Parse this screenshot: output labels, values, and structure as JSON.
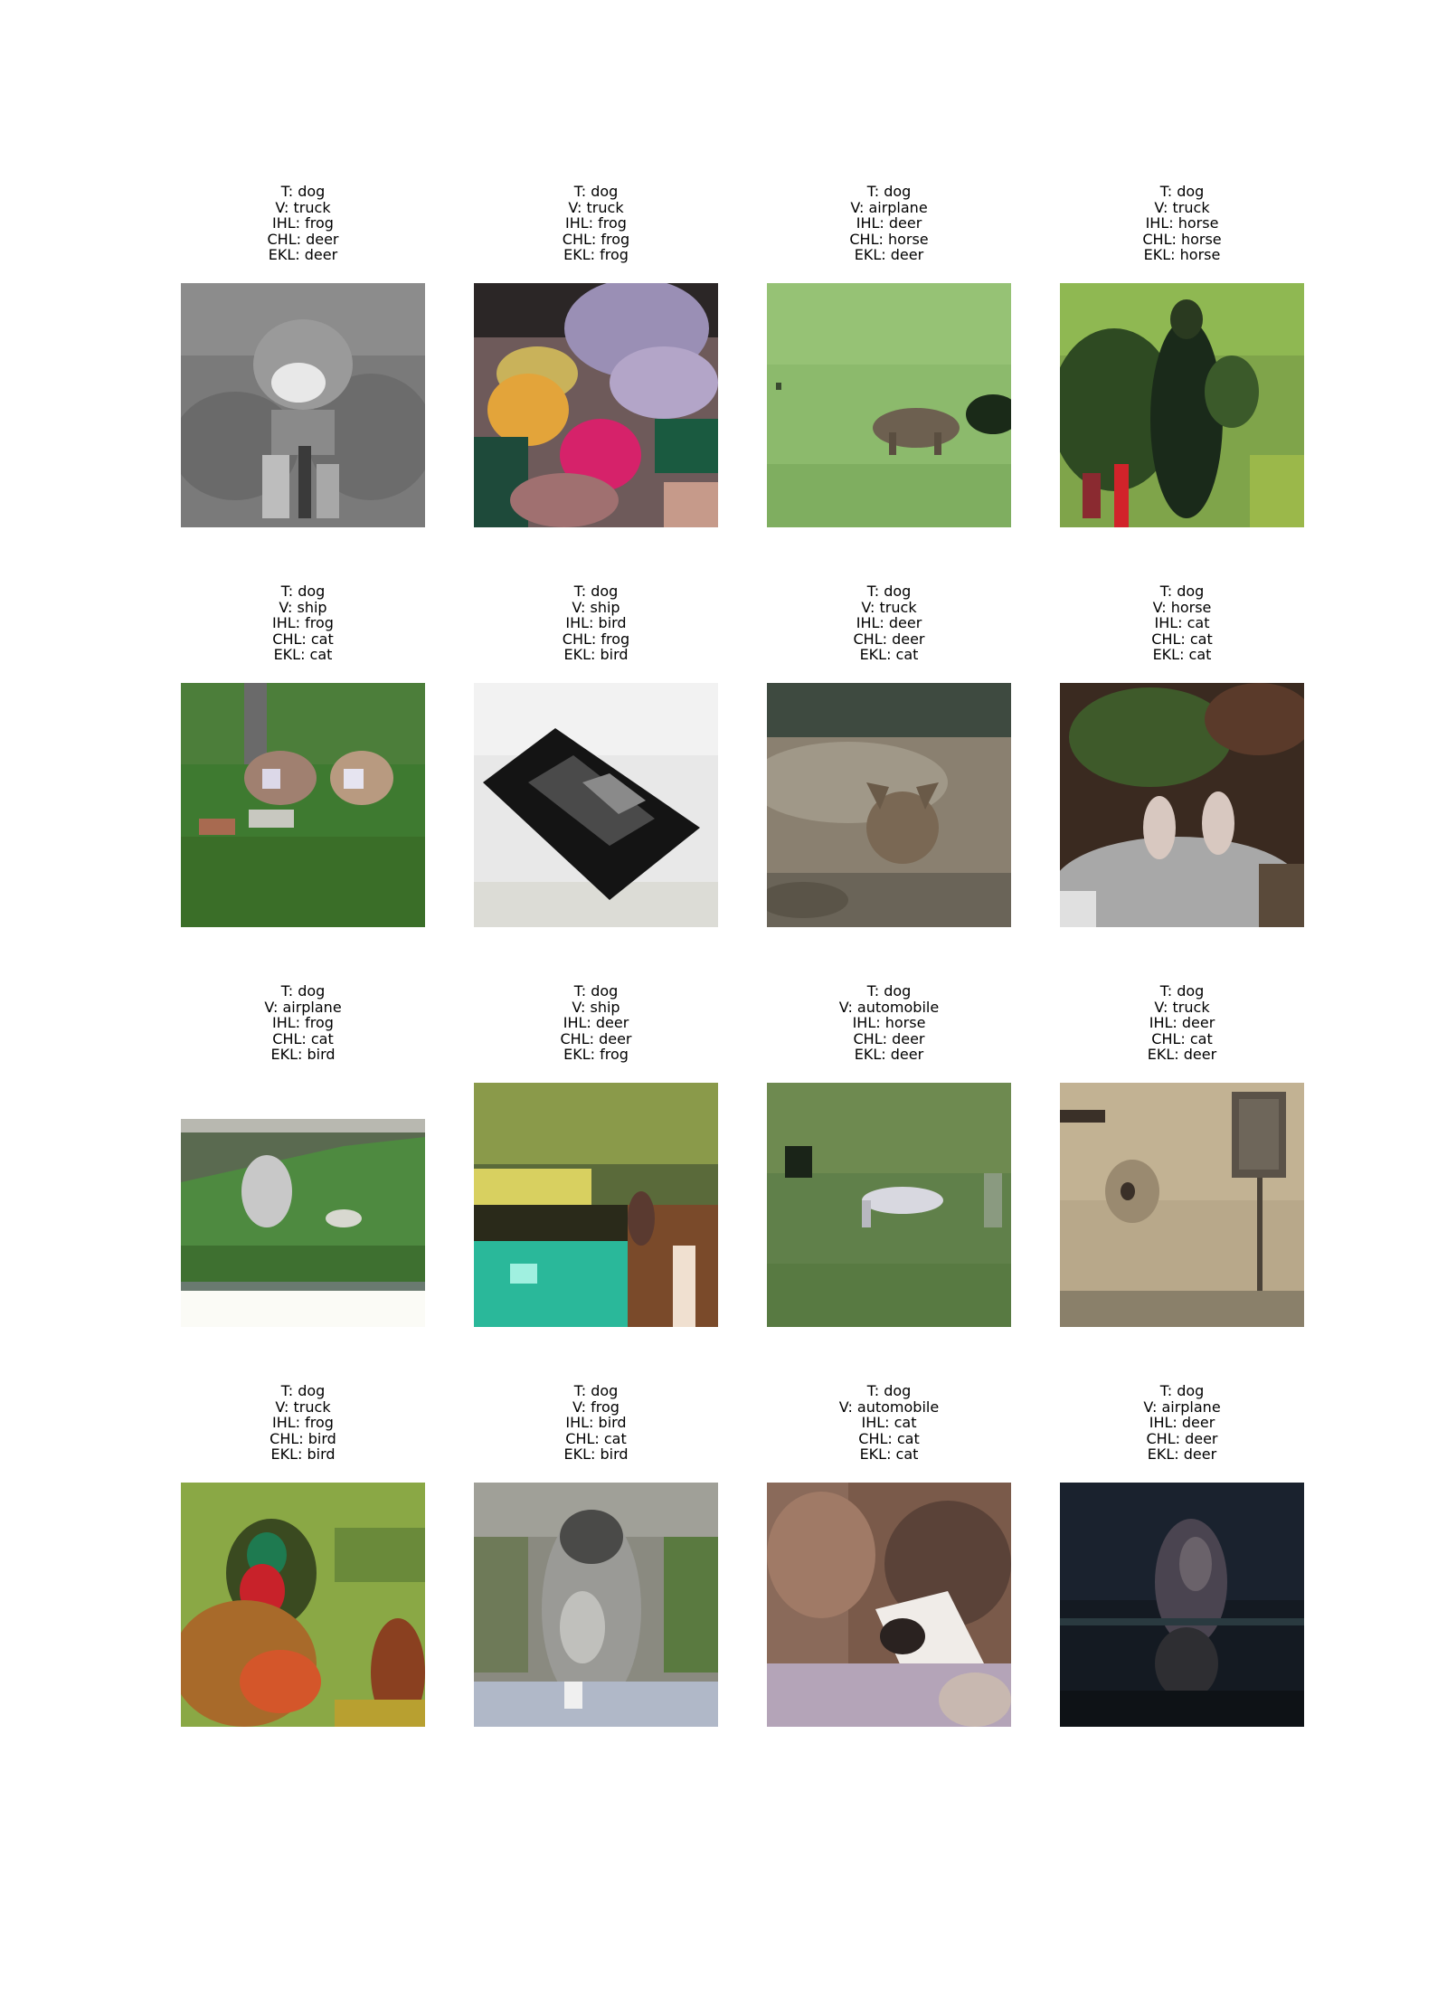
{
  "panels": [
    {
      "true_label": "T: dog",
      "v_label": "V: truck",
      "ihl_label": "IHL: frog",
      "chl_label": "CHL: deer",
      "ekl_label": "EKL: deer",
      "scene": "grayscale-dog-closeup"
    },
    {
      "true_label": "T: dog",
      "v_label": "V: truck",
      "ihl_label": "IHL: frog",
      "chl_label": "CHL: frog",
      "ekl_label": "EKL: frog",
      "scene": "colorful-flowers"
    },
    {
      "true_label": "T: dog",
      "v_label": "V: airplane",
      "ihl_label": "IHL: deer",
      "chl_label": "CHL: horse",
      "ekl_label": "EKL: deer",
      "scene": "dog-on-grass"
    },
    {
      "true_label": "T: dog",
      "v_label": "V: truck",
      "ihl_label": "IHL: horse",
      "chl_label": "CHL: horse",
      "ekl_label": "EKL: horse",
      "scene": "person-with-dog"
    },
    {
      "true_label": "T: dog",
      "v_label": "V: ship",
      "ihl_label": "IHL: frog",
      "chl_label": "CHL: cat",
      "ekl_label": "EKL: cat",
      "scene": "two-dogs-in-grass"
    },
    {
      "true_label": "T: dog",
      "v_label": "V: ship",
      "ihl_label": "IHL: bird",
      "chl_label": "CHL: frog",
      "ekl_label": "EKL: bird",
      "scene": "black-dog-on-white"
    },
    {
      "true_label": "T: dog",
      "v_label": "V: truck",
      "ihl_label": "IHL: deer",
      "chl_label": "CHL: deer",
      "ekl_label": "EKL: cat",
      "scene": "dog-on-rocks"
    },
    {
      "true_label": "T: dog",
      "v_label": "V: horse",
      "ihl_label": "IHL: cat",
      "chl_label": "CHL: cat",
      "ekl_label": "EKL: cat",
      "scene": "dog-ears-dark"
    },
    {
      "true_label": "T: dog",
      "v_label": "V: airplane",
      "ihl_label": "IHL: frog",
      "chl_label": "CHL: cat",
      "ekl_label": "EKL: bird",
      "scene": "dog-in-field-wide"
    },
    {
      "true_label": "T: dog",
      "v_label": "V: ship",
      "ihl_label": "IHL: deer",
      "chl_label": "CHL: deer",
      "ekl_label": "EKL: frog",
      "scene": "dog-by-pool"
    },
    {
      "true_label": "T: dog",
      "v_label": "V: automobile",
      "ihl_label": "IHL: horse",
      "chl_label": "CHL: deer",
      "ekl_label": "EKL: deer",
      "scene": "white-dog-running"
    },
    {
      "true_label": "T: dog",
      "v_label": "V: truck",
      "ihl_label": "IHL: deer",
      "chl_label": "CHL: cat",
      "ekl_label": "EKL: deer",
      "scene": "dog-by-wall-sign"
    },
    {
      "true_label": "T: dog",
      "v_label": "V: truck",
      "ihl_label": "IHL: frog",
      "chl_label": "CHL: bird",
      "ekl_label": "EKL: bird",
      "scene": "colorful-dog-agility"
    },
    {
      "true_label": "T: dog",
      "v_label": "V: frog",
      "ihl_label": "IHL: bird",
      "chl_label": "CHL: cat",
      "ekl_label": "EKL: bird",
      "scene": "grey-dog-sitting"
    },
    {
      "true_label": "T: dog",
      "v_label": "V: automobile",
      "ihl_label": "IHL: cat",
      "chl_label": "CHL: cat",
      "ekl_label": "EKL: cat",
      "scene": "dog-closeup-brown"
    },
    {
      "true_label": "T: dog",
      "v_label": "V: airplane",
      "ihl_label": "IHL: deer",
      "chl_label": "CHL: deer",
      "ekl_label": "EKL: deer",
      "scene": "dark-night-dog"
    }
  ]
}
